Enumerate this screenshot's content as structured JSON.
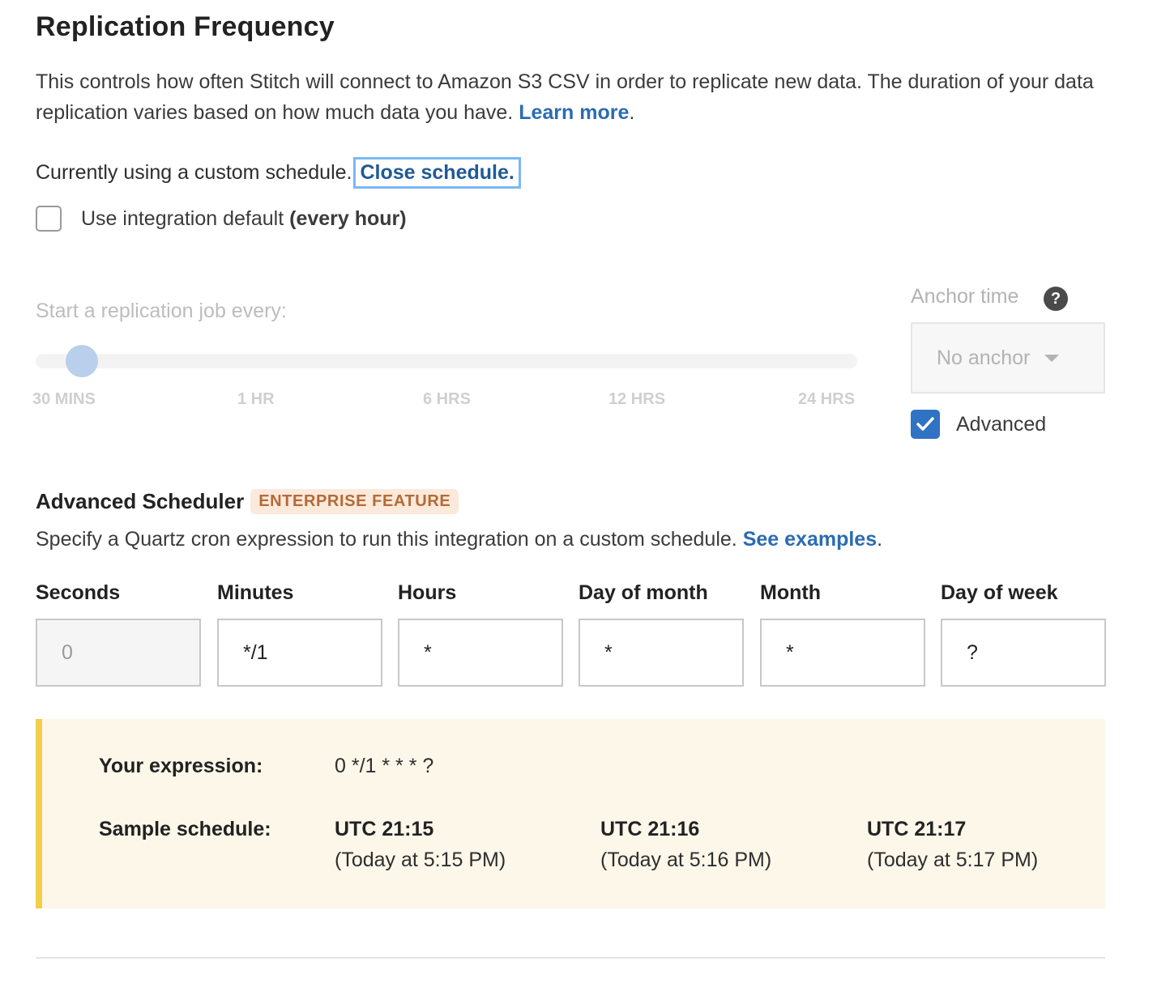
{
  "section": {
    "title": "Replication Frequency",
    "description": "This controls how often Stitch will connect to Amazon S3 CSV in order to replicate new data. The duration of your data replication varies based on how much data you have.",
    "learn_more": "Learn more",
    "period": "."
  },
  "custom_schedule": {
    "text": "Currently using a custom schedule.",
    "close_link": "Close schedule."
  },
  "integration_default": {
    "label": "Use integration default",
    "value": "(every hour)",
    "checked": false
  },
  "slider": {
    "label": "Start a replication job every:",
    "ticks": [
      "30 MINS",
      "1 HR",
      "6 HRS",
      "12 HRS",
      "24 HRS"
    ],
    "selected_index": 0
  },
  "anchor": {
    "label": "Anchor time",
    "help_icon": "?",
    "selected": "No anchor",
    "advanced_label": "Advanced",
    "advanced_checked": true
  },
  "advanced_scheduler": {
    "title": "Advanced Scheduler",
    "badge": "ENTERPRISE FEATURE",
    "description": "Specify a Quartz cron expression to run this integration on a custom schedule.",
    "examples_link": "See examples",
    "period": "."
  },
  "cron_fields": [
    {
      "label": "Seconds",
      "value": "0"
    },
    {
      "label": "Minutes",
      "value": "*/1"
    },
    {
      "label": "Hours",
      "value": "*"
    },
    {
      "label": "Day of month",
      "value": "*"
    },
    {
      "label": "Month",
      "value": "*"
    },
    {
      "label": "Day of week",
      "value": "?"
    }
  ],
  "result": {
    "expression_label": "Your expression:",
    "expression": "0 */1 * * * ?",
    "sample_label": "Sample schedule:",
    "samples": [
      {
        "utc": "UTC 21:15",
        "local": "(Today at 5:15 PM)"
      },
      {
        "utc": "UTC 21:16",
        "local": "(Today at 5:16 PM)"
      },
      {
        "utc": "UTC 21:17",
        "local": "(Today at 5:17 PM)"
      }
    ]
  },
  "colors": {
    "link": "#2b6cb0",
    "accent": "#2f73c2",
    "badge_bg": "#fbe9dc",
    "badge_text": "#b56a35",
    "panel_bg": "#fdf7ea",
    "panel_border": "#f4ce4a"
  }
}
